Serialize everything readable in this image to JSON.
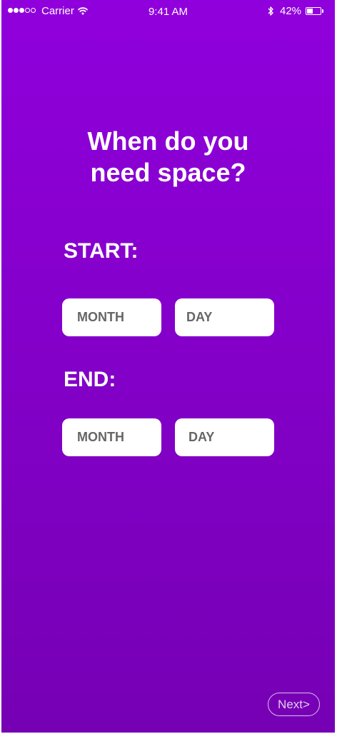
{
  "status_bar": {
    "carrier": "Carrier",
    "time": "9:41 AM",
    "battery_percent": "42%",
    "battery_level": 0.42,
    "signal_bars_filled": 3,
    "signal_bars_total": 5
  },
  "header": {
    "title": "When do you\nneed space?"
  },
  "start": {
    "label": "START:",
    "month_placeholder": "MONTH",
    "day_placeholder": "DAY"
  },
  "end": {
    "label": "END:",
    "month_placeholder": "MONTH",
    "day_placeholder": "DAY"
  },
  "footer": {
    "next_label": "Next>"
  },
  "colors": {
    "background_top": "#9000dc",
    "background_bottom": "#7600b4",
    "field_background": "#ffffff",
    "placeholder_text": "#666666",
    "text": "#ffffff"
  },
  "icons": {
    "wifi": "wifi-icon",
    "bluetooth": "bluetooth-icon",
    "battery": "battery-icon",
    "signal": "signal-dots-icon"
  }
}
